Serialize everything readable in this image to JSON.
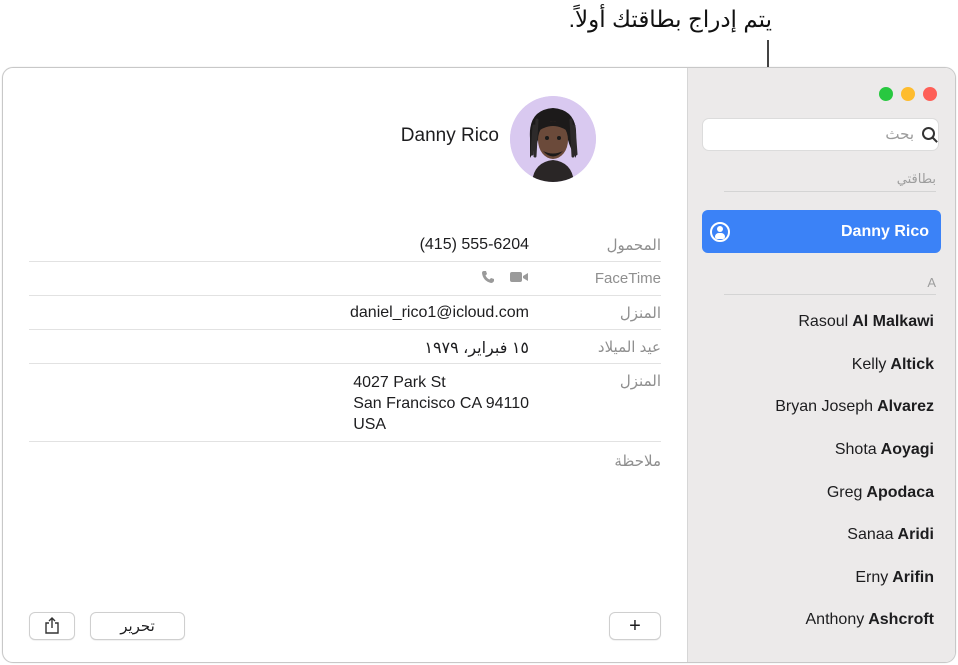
{
  "callout": {
    "text": "يتم إدراج بطاقتك أولاً."
  },
  "window": {
    "traffic_lights": {
      "close": "#fe5f57",
      "minimize": "#febc2e",
      "zoom": "#28c840"
    },
    "accent_color": "#3b82f7"
  },
  "sidebar": {
    "search_placeholder": "بحث",
    "my_card_header": "بطاقتي",
    "selected_contact": "Danny Rico",
    "section_letter": "A",
    "contacts": [
      {
        "first": "Rasoul",
        "last": "Al Malkawi"
      },
      {
        "first": "Kelly",
        "last": "Altick"
      },
      {
        "first": "Bryan Joseph",
        "last": "Alvarez"
      },
      {
        "first": "Shota",
        "last": "Aoyagi"
      },
      {
        "first": "Greg",
        "last": "Apodaca"
      },
      {
        "first": "Sanaa",
        "last": "Aridi"
      },
      {
        "first": "Erny",
        "last": "Arifin"
      },
      {
        "first": "Anthony",
        "last": "Ashcroft"
      }
    ]
  },
  "card": {
    "name": "Danny Rico",
    "fields": {
      "mobile_label": "المحمول",
      "mobile_value": "(415) 555-6204",
      "facetime_label": "FaceTime",
      "email_label": "المنزل",
      "email_value": "daniel_rico1@icloud.com",
      "birthday_label": "عيد الميلاد",
      "birthday_value": "١٥ فبراير، ١٩٧٩",
      "address_label": "المنزل",
      "address_line1": "4027 Park St",
      "address_line2": "San Francisco CA 94110",
      "address_line3": "USA",
      "note_label": "ملاحظة"
    }
  },
  "toolbar": {
    "add_label": "+",
    "edit_label": "تحرير",
    "share_icon": "share-icon"
  }
}
